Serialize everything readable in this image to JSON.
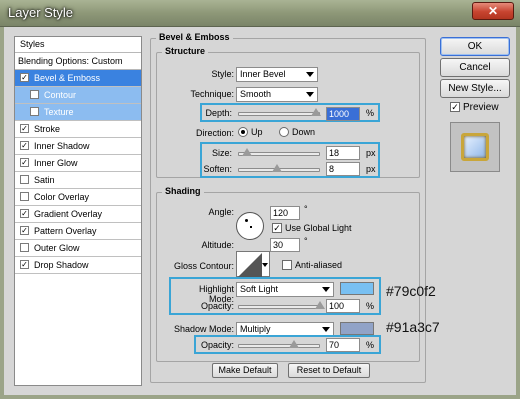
{
  "window": {
    "title": "Layer Style",
    "close_label": "✕"
  },
  "styles_panel": {
    "header": "Styles",
    "blending": "Blending Options: Custom",
    "items": [
      {
        "label": "Bevel & Emboss",
        "checked": true
      },
      {
        "label": "Contour",
        "checked": false
      },
      {
        "label": "Texture",
        "checked": false
      },
      {
        "label": "Stroke",
        "checked": true
      },
      {
        "label": "Inner Shadow",
        "checked": true
      },
      {
        "label": "Inner Glow",
        "checked": true
      },
      {
        "label": "Satin",
        "checked": false
      },
      {
        "label": "Color Overlay",
        "checked": false
      },
      {
        "label": "Gradient Overlay",
        "checked": true
      },
      {
        "label": "Pattern Overlay",
        "checked": true
      },
      {
        "label": "Outer Glow",
        "checked": false
      },
      {
        "label": "Drop Shadow",
        "checked": true
      }
    ]
  },
  "bevel": {
    "group_title": "Bevel & Emboss",
    "structure": {
      "title": "Structure",
      "style_label": "Style:",
      "style_value": "Inner Bevel",
      "technique_label": "Technique:",
      "technique_value": "Smooth",
      "depth_label": "Depth:",
      "depth_value": "1000",
      "depth_unit": "%",
      "depth_level": 1.0,
      "direction_label": "Direction:",
      "up_label": "Up",
      "down_label": "Down",
      "direction_value": "Up",
      "size_label": "Size:",
      "size_value": "18",
      "size_unit": "px",
      "soften_label": "Soften:",
      "soften_value": "8",
      "soften_unit": "px"
    },
    "shading": {
      "title": "Shading",
      "angle_label": "Angle:",
      "angle_value": "120",
      "degree": "°",
      "global_light_label": "Use Global Light",
      "global_light": true,
      "altitude_label": "Altitude:",
      "altitude_value": "30",
      "gloss_label": "Gloss Contour:",
      "antialiased_label": "Anti-aliased",
      "antialiased": false,
      "highlight_label": "Highlight Mode:",
      "highlight_value": "Soft Light",
      "highlight_color": "#79c0f2",
      "highlight_opacity_label": "Opacity:",
      "highlight_opacity_value": "100",
      "highlight_opacity_unit": "%",
      "shadow_label": "Shadow Mode:",
      "shadow_value": "Multiply",
      "shadow_color": "#91a3c7",
      "shadow_opacity_label": "Opacity:",
      "shadow_opacity_value": "70",
      "shadow_opacity_unit": "%"
    },
    "make_default": "Make Default",
    "reset_default": "Reset to Default"
  },
  "annotations": {
    "highlight_hex": "#79c0f2",
    "shadow_hex": "#91a3c7"
  },
  "buttons": {
    "ok": "OK",
    "cancel": "Cancel",
    "new_style": "New Style...",
    "preview": "Preview",
    "preview_checked": true
  }
}
